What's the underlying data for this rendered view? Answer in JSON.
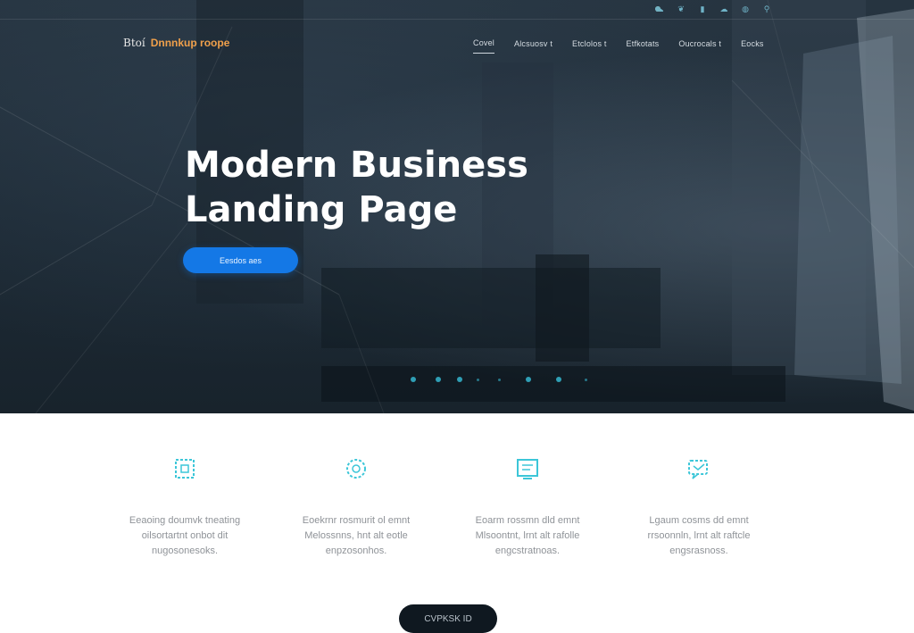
{
  "top_icons": [
    "cloud-icon",
    "leaf-icon",
    "bookmark-icon",
    "circle-icon",
    "cloud-icon",
    "globe-icon",
    "dot-icon",
    "dot-icon",
    "link-icon"
  ],
  "brand": {
    "mark": "Btoí",
    "name": "Dnnnkup roope"
  },
  "nav": {
    "items": [
      "Covel",
      "Alcsuosv t",
      "Etclolos t",
      "Etfkotats",
      "Oucrocals t",
      "Eocks"
    ],
    "active_index": 0
  },
  "hero": {
    "title_line1": "Modern Business",
    "title_line2": "Landing Page",
    "cta_label": "Eesdos aes"
  },
  "features": [
    {
      "icon": "grid-icon",
      "lines": [
        "Eeaoing doumvk tneating",
        "oilsortartnt onbot dit",
        "nugosonesoks."
      ]
    },
    {
      "icon": "gear-icon",
      "lines": [
        "Eoekrnr rosmurit ol emnt",
        "Melossnns, hnt  alt eotle",
        "enpzosonhos."
      ]
    },
    {
      "icon": "screen-icon",
      "lines": [
        "Eoarm rossmn dld emnt",
        "Mlsoontnt, lrnt alt rafolle",
        "engcstratnoas."
      ]
    },
    {
      "icon": "chat-icon",
      "lines": [
        "Lgaum cosms dd emnt",
        "rrsoonnln, lrnt alt raftcle",
        "engsrasnoss."
      ]
    }
  ],
  "accent_colors": {
    "brand": "#f0a04b",
    "cta": "#1478e6",
    "icons": "#3cc6d8",
    "dark_button": "#0f1820"
  },
  "bottom_button": {
    "label": "CVPKSK ID"
  }
}
